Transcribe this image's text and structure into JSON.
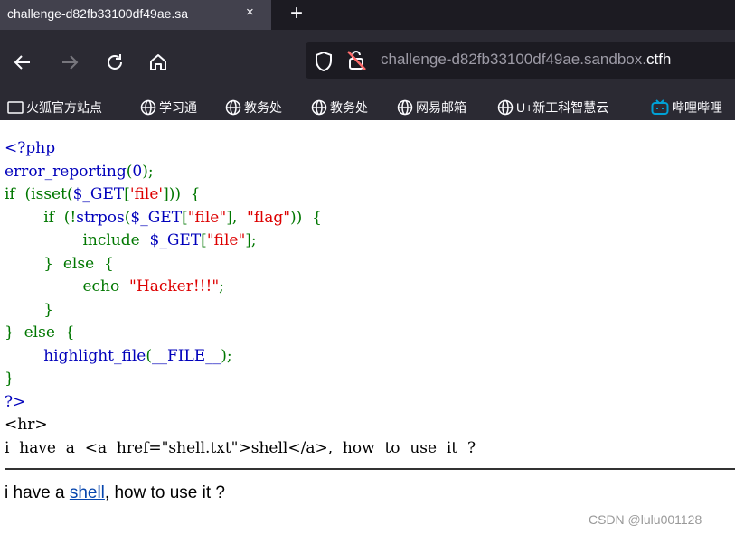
{
  "browser": {
    "tab_title": "challenge-d82fb33100df49ae.sa",
    "tab_close": "×",
    "new_tab": "+",
    "url_prefix": "challenge-d82fb33100df49ae.sandbox.",
    "url_domain": "ctfh",
    "bookmarks": [
      "火狐官方站点",
      "学习通",
      "教务处",
      "教务处",
      "网易邮箱",
      "U+新工科智慧云",
      "哔哩哔哩"
    ]
  },
  "code_lines": [
    [
      {
        "c": "def",
        "t": "<?php"
      }
    ],
    [
      {
        "c": "def",
        "t": "error_reporting"
      },
      {
        "c": "kw",
        "t": "("
      },
      {
        "c": "def",
        "t": "0"
      },
      {
        "c": "kw",
        "t": ");"
      }
    ],
    [
      {
        "c": "kw",
        "t": "if  (isset("
      },
      {
        "c": "def",
        "t": "$_GET"
      },
      {
        "c": "kw",
        "t": "["
      },
      {
        "c": "str",
        "t": "'file'"
      },
      {
        "c": "kw",
        "t": "]))  {"
      }
    ],
    [
      {
        "c": "kw",
        "t": "        if  (!"
      },
      {
        "c": "def",
        "t": "strpos"
      },
      {
        "c": "kw",
        "t": "("
      },
      {
        "c": "def",
        "t": "$_GET"
      },
      {
        "c": "kw",
        "t": "["
      },
      {
        "c": "str",
        "t": "\"file\""
      },
      {
        "c": "kw",
        "t": "],  "
      },
      {
        "c": "str",
        "t": "\"flag\""
      },
      {
        "c": "kw",
        "t": "))  {"
      }
    ],
    [
      {
        "c": "kw",
        "t": "                include  "
      },
      {
        "c": "def",
        "t": "$_GET"
      },
      {
        "c": "kw",
        "t": "["
      },
      {
        "c": "str",
        "t": "\"file\""
      },
      {
        "c": "kw",
        "t": "];"
      }
    ],
    [
      {
        "c": "kw",
        "t": "        }  else  {"
      }
    ],
    [
      {
        "c": "kw",
        "t": "                echo  "
      },
      {
        "c": "str",
        "t": "\"Hacker!!!\""
      },
      {
        "c": "kw",
        "t": ";"
      }
    ],
    [
      {
        "c": "kw",
        "t": "        }"
      }
    ],
    [
      {
        "c": "kw",
        "t": "}  else  {"
      }
    ],
    [
      {
        "c": "kw",
        "t": "        "
      },
      {
        "c": "def",
        "t": "highlight_file"
      },
      {
        "c": "kw",
        "t": "("
      },
      {
        "c": "def",
        "t": "__FILE__"
      },
      {
        "c": "kw",
        "t": ");"
      }
    ],
    [
      {
        "c": "kw",
        "t": "}"
      }
    ],
    [
      {
        "c": "def",
        "t": "?>"
      }
    ],
    [
      {
        "c": "html",
        "t": "<hr>"
      }
    ],
    [
      {
        "c": "html",
        "t": "i  have  a  <a  href=\"shell.txt\">shell</a>,  how  to  use  it  ?"
      }
    ]
  ],
  "page": {
    "text_before": "i have a ",
    "link_text": "shell",
    "text_after": ", how to use it ?",
    "watermark": "CSDN @lulu001128"
  }
}
